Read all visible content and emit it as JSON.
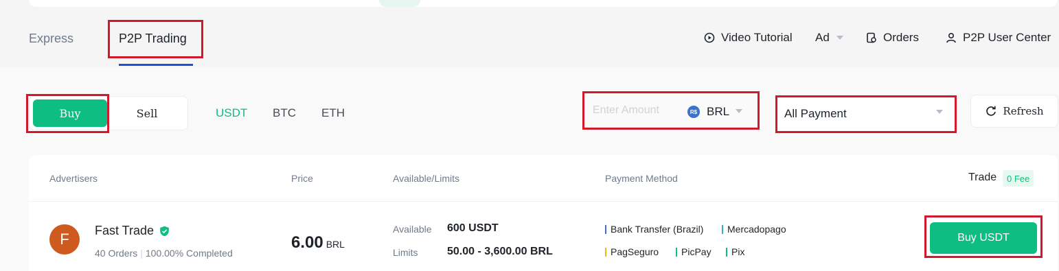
{
  "tabs": {
    "express": "Express",
    "p2p": "P2P Trading"
  },
  "nav": {
    "video_tutorial": "Video Tutorial",
    "ad": "Ad",
    "orders": "Orders",
    "user_center": "P2P User Center"
  },
  "side_toggle": {
    "buy": "Buy",
    "sell": "Sell",
    "selected": "Buy"
  },
  "coins": [
    "USDT",
    "BTC",
    "ETH"
  ],
  "selected_coin": "USDT",
  "amount": {
    "placeholder": "Enter Amount",
    "currency_badge": "R$",
    "currency": "BRL"
  },
  "payment_filter": "All Payment",
  "refresh_label": "Refresh",
  "table": {
    "headers": {
      "advertisers": "Advertisers",
      "price": "Price",
      "available": "Available/Limits",
      "payment": "Payment Method",
      "trade": "Trade",
      "fee": "0 Fee"
    },
    "rows": [
      {
        "avatar": "F",
        "name": "Fast Trade",
        "orders": "40 Orders",
        "completion": "100.00% Completed",
        "price": "6.00",
        "price_currency": "BRL",
        "available_label": "Available",
        "available": "600 USDT",
        "limits_label": "Limits",
        "limits": "50.00 - 3,600.00 BRL",
        "payments": [
          {
            "name": "Bank Transfer (Brazil)",
            "color": "#3a6fd8"
          },
          {
            "name": "Mercadopago",
            "color": "#2bb0d6"
          },
          {
            "name": "PagSeguro",
            "color": "#f0b90b"
          },
          {
            "name": "PicPay",
            "color": "#0ebd81"
          },
          {
            "name": "Pix",
            "color": "#0ebd81"
          }
        ],
        "action": "Buy USDT"
      }
    ]
  },
  "colors": {
    "accent": "#0ebd81",
    "highlight": "#d0192a",
    "tab_underline": "#1f4fd6"
  }
}
